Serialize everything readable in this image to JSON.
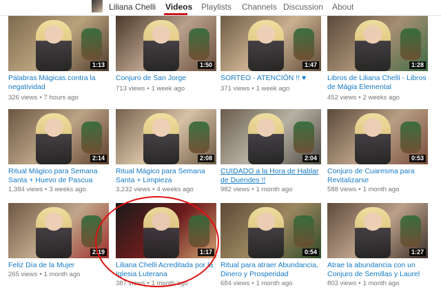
{
  "header": {
    "channel_name": "Liliana Chelli",
    "tabs": [
      "Videos",
      "Playlists",
      "Channels",
      "Discussion",
      "About"
    ],
    "active_tab": "Videos"
  },
  "videos": [
    {
      "title": "Palabras Mágicas contra la negatividad",
      "duration": "1:13",
      "views": "326 views",
      "age": "7 hours ago"
    },
    {
      "title": "Conjuro de San Jorge",
      "duration": "1:50",
      "views": "713 views",
      "age": "1 week ago"
    },
    {
      "title": "SORTEO - ATENCIÓN !! ♥",
      "duration": "1:47",
      "views": "371 views",
      "age": "1 week ago"
    },
    {
      "title": "Libros de Liliana Chelli - Libros de Mágia Elemental",
      "duration": "1:28",
      "views": "452 views",
      "age": "2 weeks ago"
    },
    {
      "title": "Ritual Mágico para Semana Santa + Huevo de Pascua",
      "duration": "2:14",
      "views": "1,384 views",
      "age": "3 weeks ago"
    },
    {
      "title": "Ritual Mágico para Semana Santa + Limpieza",
      "duration": "2:08",
      "views": "3,232 views",
      "age": "4 weeks ago"
    },
    {
      "title": "CUIDADO a la Hora de Hablar de Duendes !!",
      "duration": "2:04",
      "views": "982 views",
      "age": "1 month ago"
    },
    {
      "title": "Conjuro de Cuaresma para Revitalizarse",
      "duration": "0:53",
      "views": "588 views",
      "age": "1 month ago"
    },
    {
      "title": "Feliz Día de la Mujer",
      "duration": "2:19",
      "views": "265 views",
      "age": "1 month ago"
    },
    {
      "title": "Liliana Chelli Acreditada por la Iglesia Luterana",
      "duration": "1:17",
      "views": "387 views",
      "age": "1 month ago"
    },
    {
      "title": "Ritual para atraer Abundancia, Dinero y Prosperidad",
      "duration": "0:54",
      "views": "684 views",
      "age": "1 month ago"
    },
    {
      "title": "Atrae la abundancia con un Conjuro de Semillas y Laurel",
      "duration": "1:27",
      "views": "803 views",
      "age": "1 month ago"
    }
  ],
  "colors": {
    "link": "#167ac6",
    "meta": "#767676",
    "active_tab_underline": "#cc181e",
    "annotation_circle": "#e01010"
  }
}
